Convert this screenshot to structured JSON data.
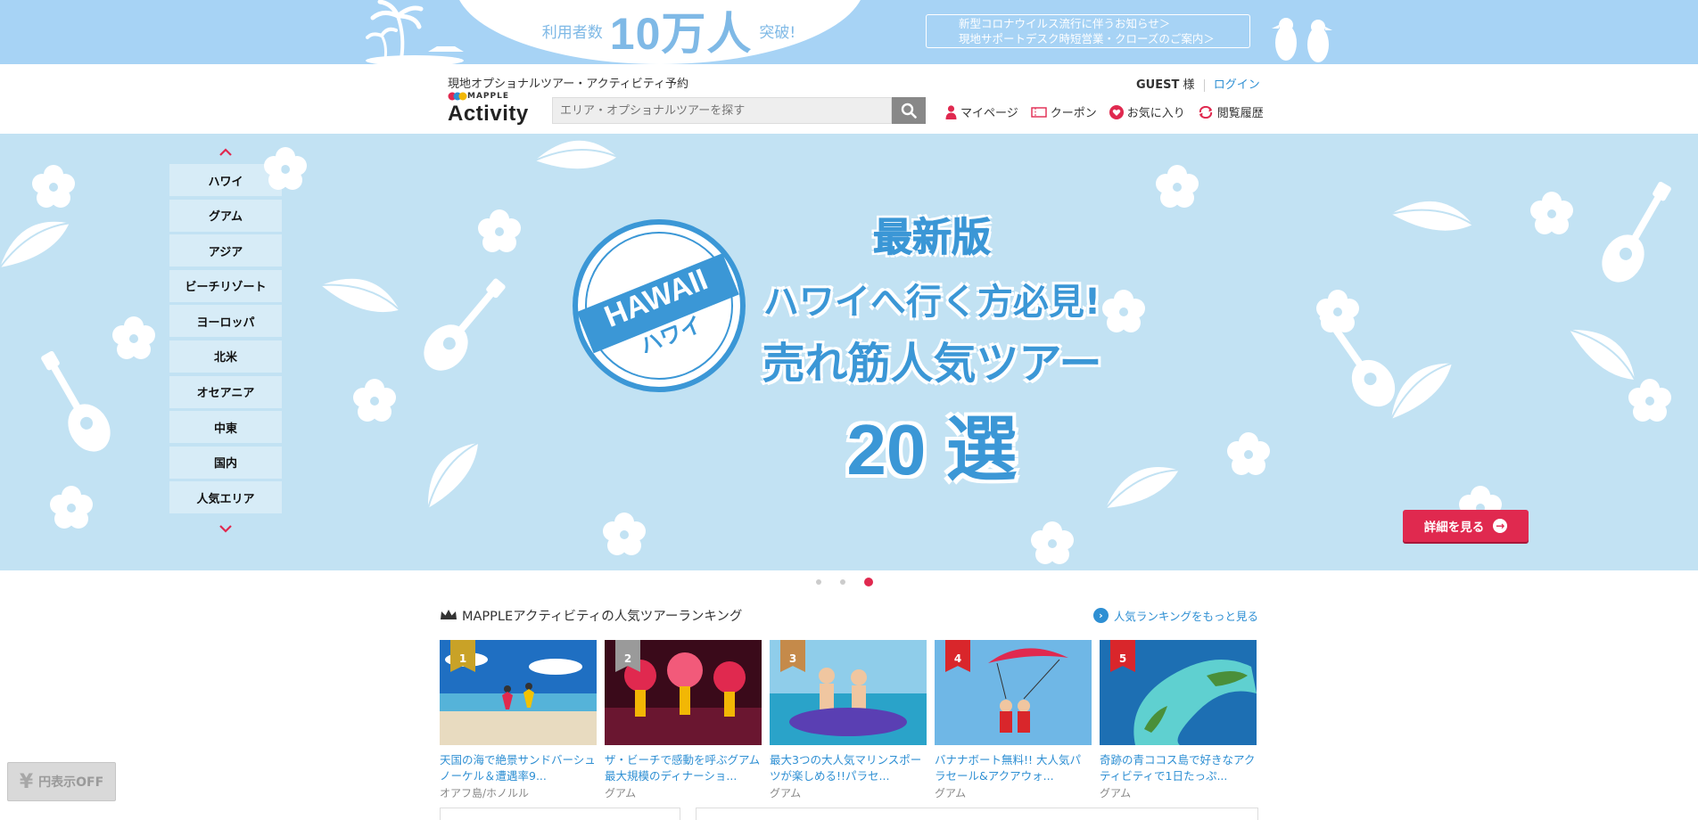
{
  "top_banner": {
    "users_prefix": "利用者数",
    "users_count": "10万人",
    "users_suffix": "突破!",
    "notice_line1": "新型コロナウイルス流行に伴うお知らせ＞",
    "notice_line2": "現地サポートデスク時短営業・クローズのご案内＞"
  },
  "header": {
    "tagline": "現地オプショナルツアー・アクティビティ予約",
    "logo_small": "MAPPLE",
    "logo_main": "Activity",
    "search_placeholder": "エリア・オプショナルツアーを探す",
    "guest_name": "GUEST",
    "guest_suffix": "様",
    "login_label": "ログイン",
    "nav": {
      "mypage": "マイページ",
      "coupon": "クーポン",
      "favorites": "お気に入り",
      "history": "閲覧履歴"
    }
  },
  "hero": {
    "regions": [
      "ハワイ",
      "グアム",
      "アジア",
      "ビーチリゾート",
      "ヨーロッパ",
      "北米",
      "オセアニア",
      "中東",
      "国内",
      "人気エリア"
    ],
    "stamp_en": "HAWAII",
    "stamp_ja": "ハワイ",
    "headline_latest": "最新版",
    "headline_line2": "ハワイへ行く方必見!",
    "headline_line3": "売れ筋人気ツアー",
    "headline_line4": "20 選",
    "detail_button": "詳細を見る",
    "slides_total": 3,
    "slide_active": 3
  },
  "ranking": {
    "title": "MAPPLEアクティビティの人気ツアーランキング",
    "more_link": "人気ランキングをもっと見る",
    "items": [
      {
        "rank": "1",
        "name": "天国の海で絶景サンドバーシュノーケル＆遭遇率9...",
        "area": "オアフ島/ホノルル",
        "badge_color": "#c9a227"
      },
      {
        "rank": "2",
        "name": "ザ・ビーチで感動を呼ぶグアム最大規模のディナーショ...",
        "area": "グアム",
        "badge_color": "#9a9a9a"
      },
      {
        "rank": "3",
        "name": "最大3つの大人気マリンスポーツが楽しめる!!パラセ...",
        "area": "グアム",
        "badge_color": "#c58a4a"
      },
      {
        "rank": "4",
        "name": "バナナボート無料!! 大人気パラセール&アクアウォ...",
        "area": "グアム",
        "badge_color": "#d9262b"
      },
      {
        "rank": "5",
        "name": "奇跡の青ココス島で好きなアクティビティで1日たっぷ...",
        "area": "グアム",
        "badge_color": "#d9262b"
      }
    ]
  },
  "yen_toggle": {
    "symbol": "¥",
    "label": "円表示OFF"
  },
  "colors": {
    "accent_red": "#e0294f",
    "link_blue": "#2e8fd3",
    "banner_blue": "#a7d3f5",
    "hero_blue": "#c2e2f3"
  }
}
